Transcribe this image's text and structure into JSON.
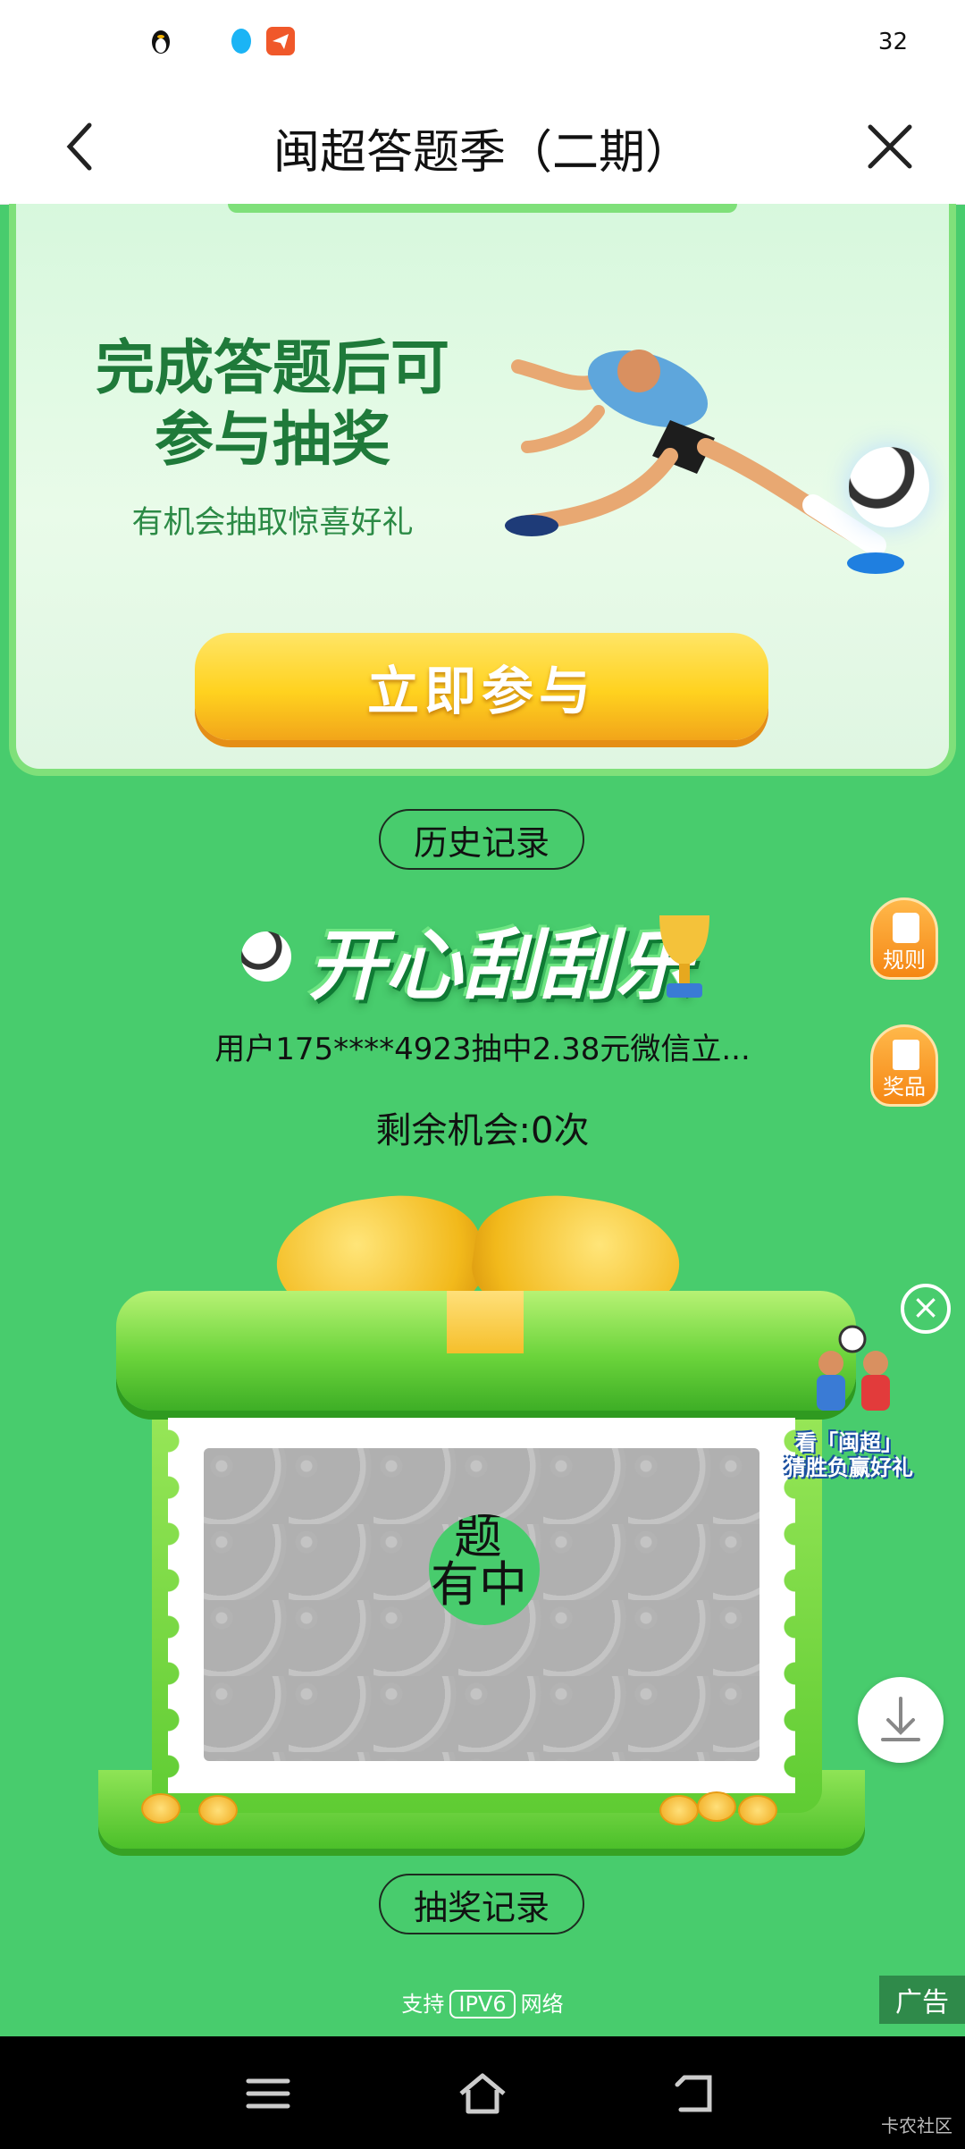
{
  "status_bar": {
    "time": "32"
  },
  "header": {
    "title": "闽超答题季（二期）"
  },
  "promo": {
    "headline_1": "完成答题后可",
    "headline_2": "参与抽奖",
    "subtitle": "有机会抽取惊喜好礼",
    "join_button": "立即参与"
  },
  "history_button": "历史记录",
  "game": {
    "title": "开心刮刮乐",
    "ticker": "用户175****4923抽中2.38元微信立...",
    "remaining": "剩余机会:0次",
    "reveal_text_1": "题",
    "reveal_text_2": "有中"
  },
  "side_buttons": {
    "rules": "规则",
    "prizes": "奖品"
  },
  "floating_ad": {
    "line1": "看「闽超」",
    "line2": "猜胜负赢好礼"
  },
  "draw_record_button": "抽奖记录",
  "footer": {
    "prefix": "支持",
    "badge": "IPV6",
    "suffix": "网络",
    "ad_tag": "广告"
  },
  "watermark": "卡农社区",
  "colors": {
    "page_bg": "#48cc6d",
    "accent_yellow": "#ffd21f",
    "orange": "#f58714"
  }
}
